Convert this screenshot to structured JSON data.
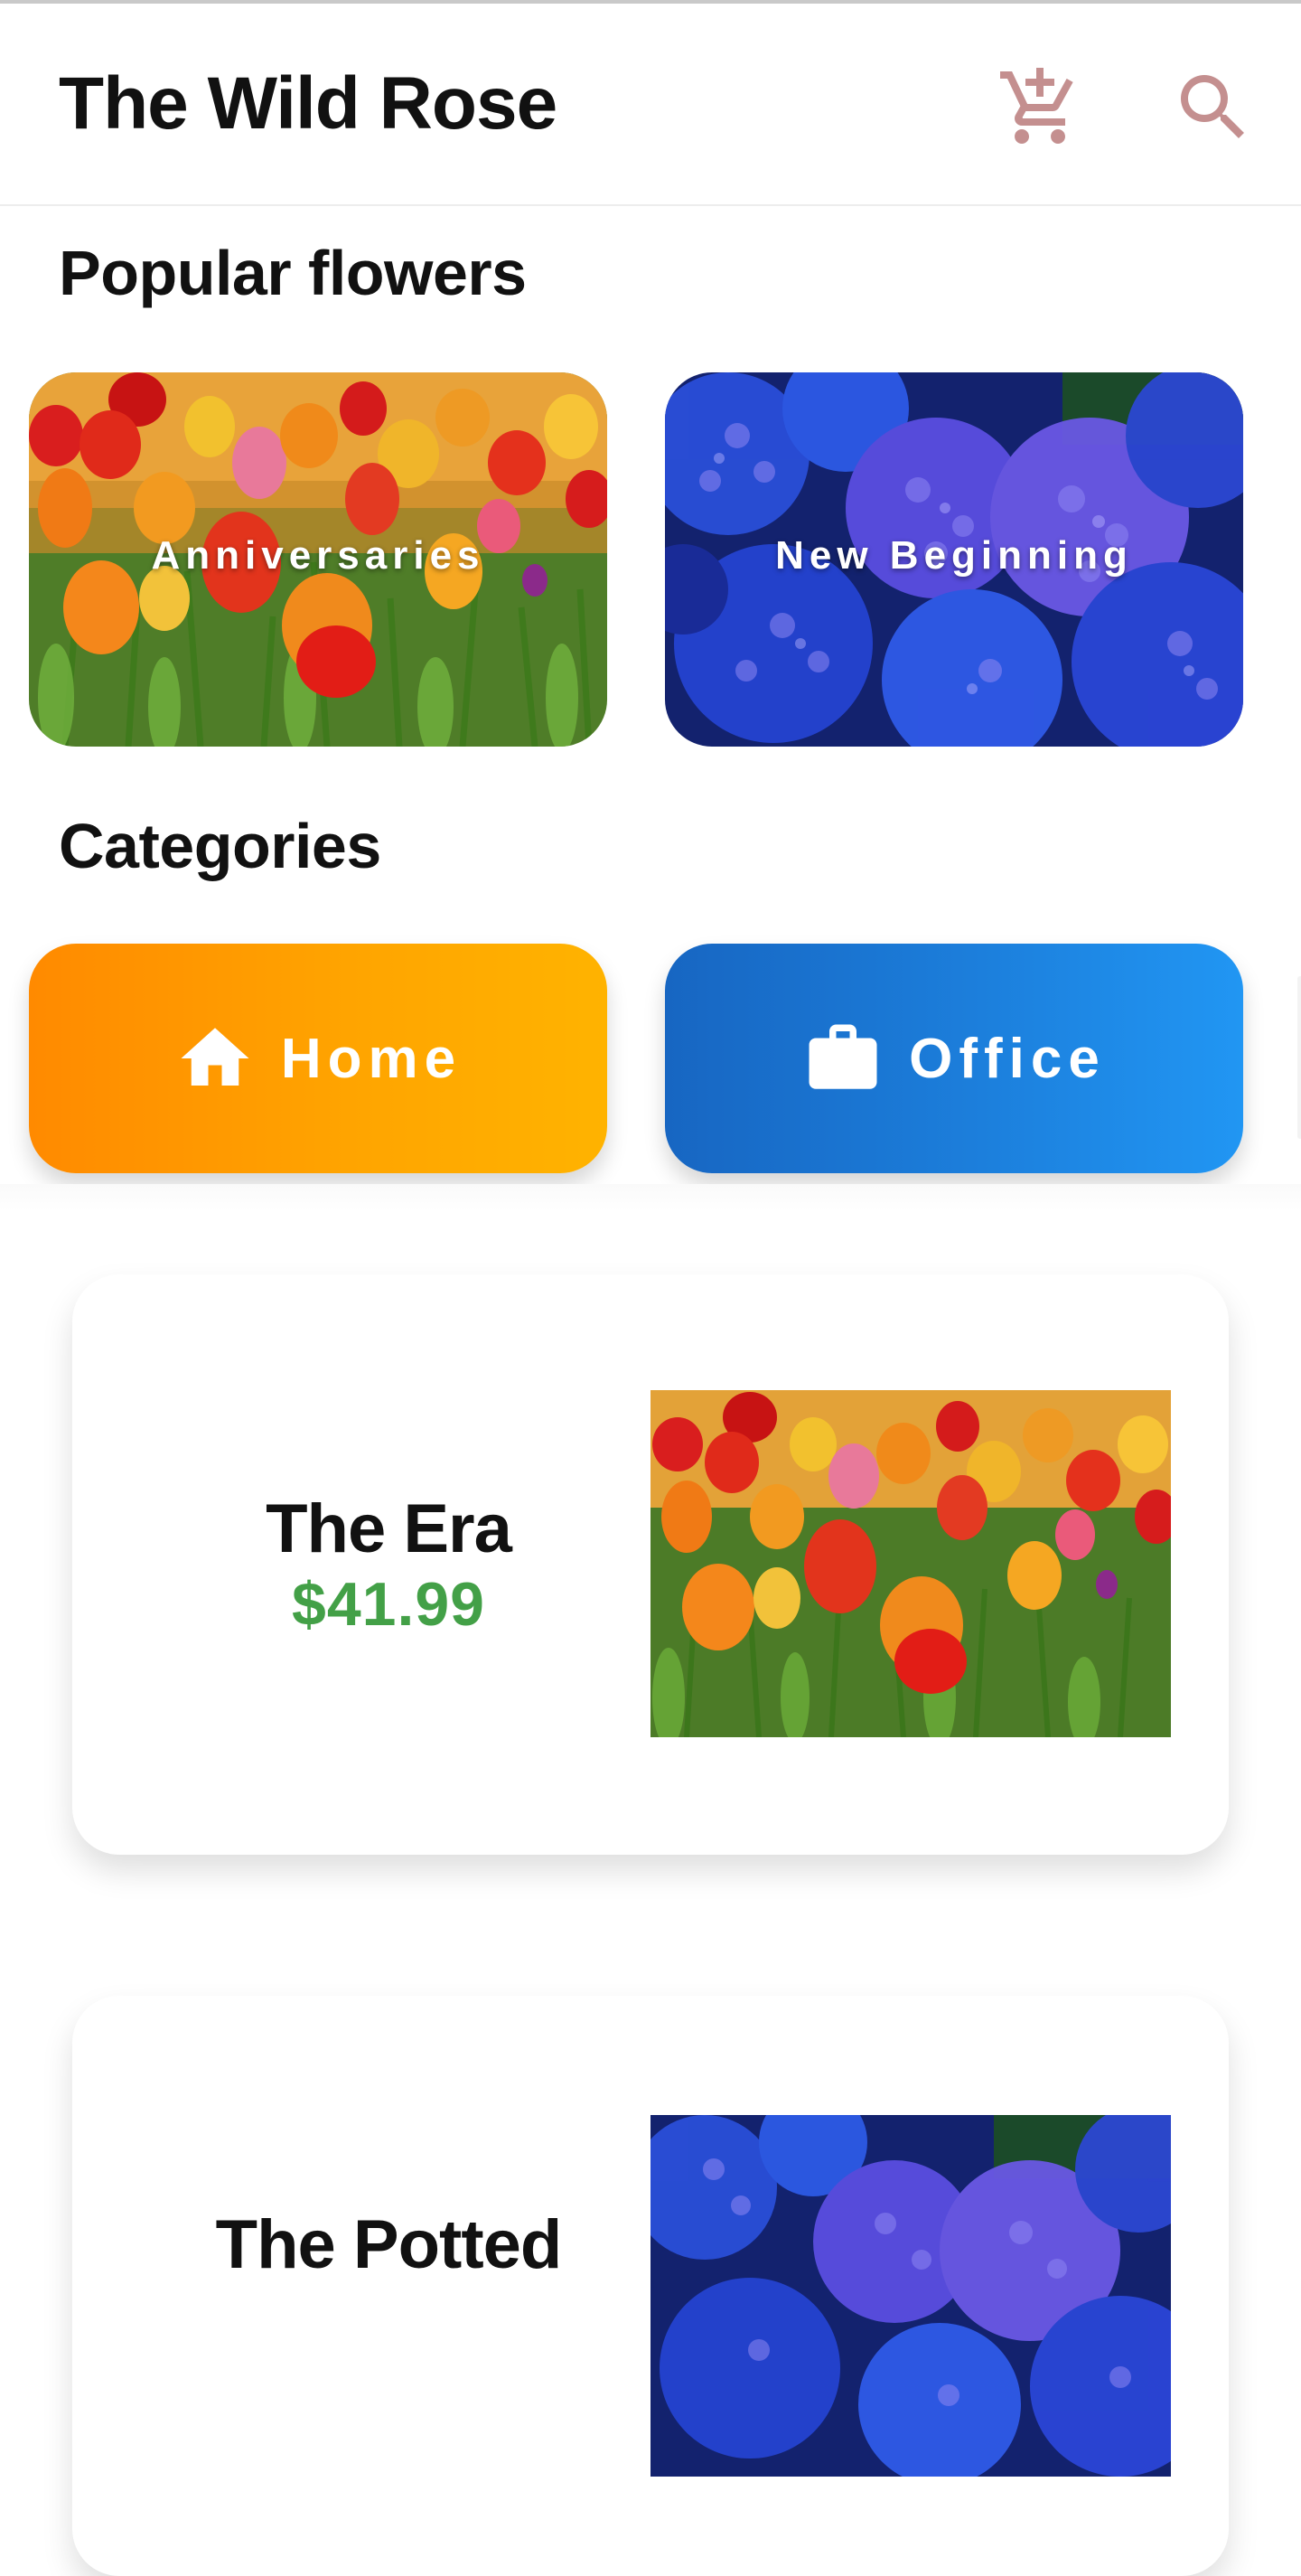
{
  "app": {
    "title": "The Wild Rose"
  },
  "toolbar": {
    "cart_icon": "add-shopping-cart-icon",
    "search_icon": "search-icon"
  },
  "popular": {
    "title": "Popular flowers",
    "items": [
      {
        "label": "Anniversaries",
        "image": "tulips-image"
      },
      {
        "label": "New Beginning",
        "image": "blue-hydrangeas-image"
      }
    ]
  },
  "categories": {
    "title": "Categories",
    "items": [
      {
        "label": "Home",
        "icon": "home-icon",
        "colors": [
          "#ff8a00",
          "#ffb300"
        ]
      },
      {
        "label": "Office",
        "icon": "briefcase-icon",
        "colors": [
          "#1766c2",
          "#2196f3"
        ]
      }
    ]
  },
  "products": [
    {
      "name": "The Era",
      "price": "$41.99",
      "image": "tulips-image"
    },
    {
      "name": "The Potted",
      "price": "",
      "image": "blue-hydrangeas-image"
    }
  ],
  "colors": {
    "price": "#43a047",
    "icon_tint": "#c48f8f"
  }
}
